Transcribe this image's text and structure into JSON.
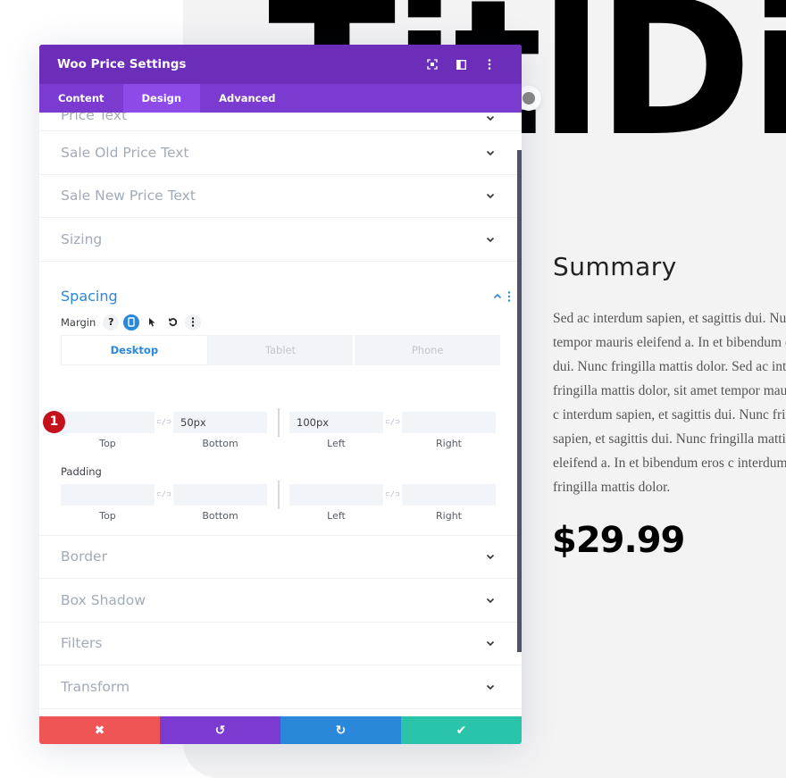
{
  "page": {
    "hero_hidden": "Title",
    "hero_visible": "Di",
    "summary_title": "Summary",
    "summary_lines": [
      "Sed ac interdum sapien, et sagittis dui. Nunc fringilla mattis dolor, sit amet",
      "tempor mauris eleifend a. In et bibendum eros c interdum sapien, et sagittis",
      "dui. Nunc fringilla mattis dolor. Sed ac interdum sapien, et sagittis dui. Nunc",
      "fringilla mattis dolor, sit amet tempor mauris eleifend a. In et bibendum eros",
      "c interdum sapien, et sagittis dui. Nunc fringilla mattis dolor. Sed ac interdum",
      "sapien, et sagittis dui. Nunc fringilla mattis dolor, sit amet tempor mauris",
      "eleifend a. In et bibendum eros c interdum sapien, et sagittis dui. Nunc",
      "fringilla mattis dolor."
    ],
    "price": "$29.99"
  },
  "modal": {
    "title": "Woo Price Settings",
    "header_icons": [
      "expand-icon",
      "split-view-icon",
      "more-options-icon"
    ],
    "tabs": [
      {
        "label": "Content",
        "active": false
      },
      {
        "label": "Design",
        "active": true
      },
      {
        "label": "Advanced",
        "active": false
      }
    ],
    "toggles_before": [
      "Price Text",
      "Sale Old Price Text",
      "Sale New Price Text",
      "Sizing"
    ],
    "spacing": {
      "title": "Spacing",
      "margin_label": "Margin",
      "device_tabs": [
        {
          "label": "Desktop",
          "active": true
        },
        {
          "label": "Tablet",
          "active": false
        },
        {
          "label": "Phone",
          "active": false
        }
      ],
      "margin": {
        "top": {
          "value": "",
          "label": "Top"
        },
        "bottom": {
          "value": "50px",
          "label": "Bottom"
        },
        "left": {
          "value": "100px",
          "label": "Left"
        },
        "right": {
          "value": "",
          "label": "Right"
        }
      },
      "padding_label": "Padding",
      "padding": {
        "top": {
          "value": "",
          "label": "Top"
        },
        "bottom": {
          "value": "",
          "label": "Bottom"
        },
        "left": {
          "value": "",
          "label": "Left"
        },
        "right": {
          "value": "",
          "label": "Right"
        }
      },
      "step_badge": "1"
    },
    "toggles_after": [
      "Border",
      "Box Shadow",
      "Filters",
      "Transform"
    ],
    "footer": {
      "cancel_icon": "✖",
      "undo_icon": "↺",
      "redo_icon": "↻",
      "save_icon": "✔"
    }
  },
  "colors": {
    "header": "#6c2eb9",
    "tabs": "#7b3bd0",
    "active_tab": "#8e4ae8",
    "accent_blue": "#2b87da",
    "cancel": "#ef5555",
    "save": "#29c4a9",
    "badge": "#c4111b"
  }
}
